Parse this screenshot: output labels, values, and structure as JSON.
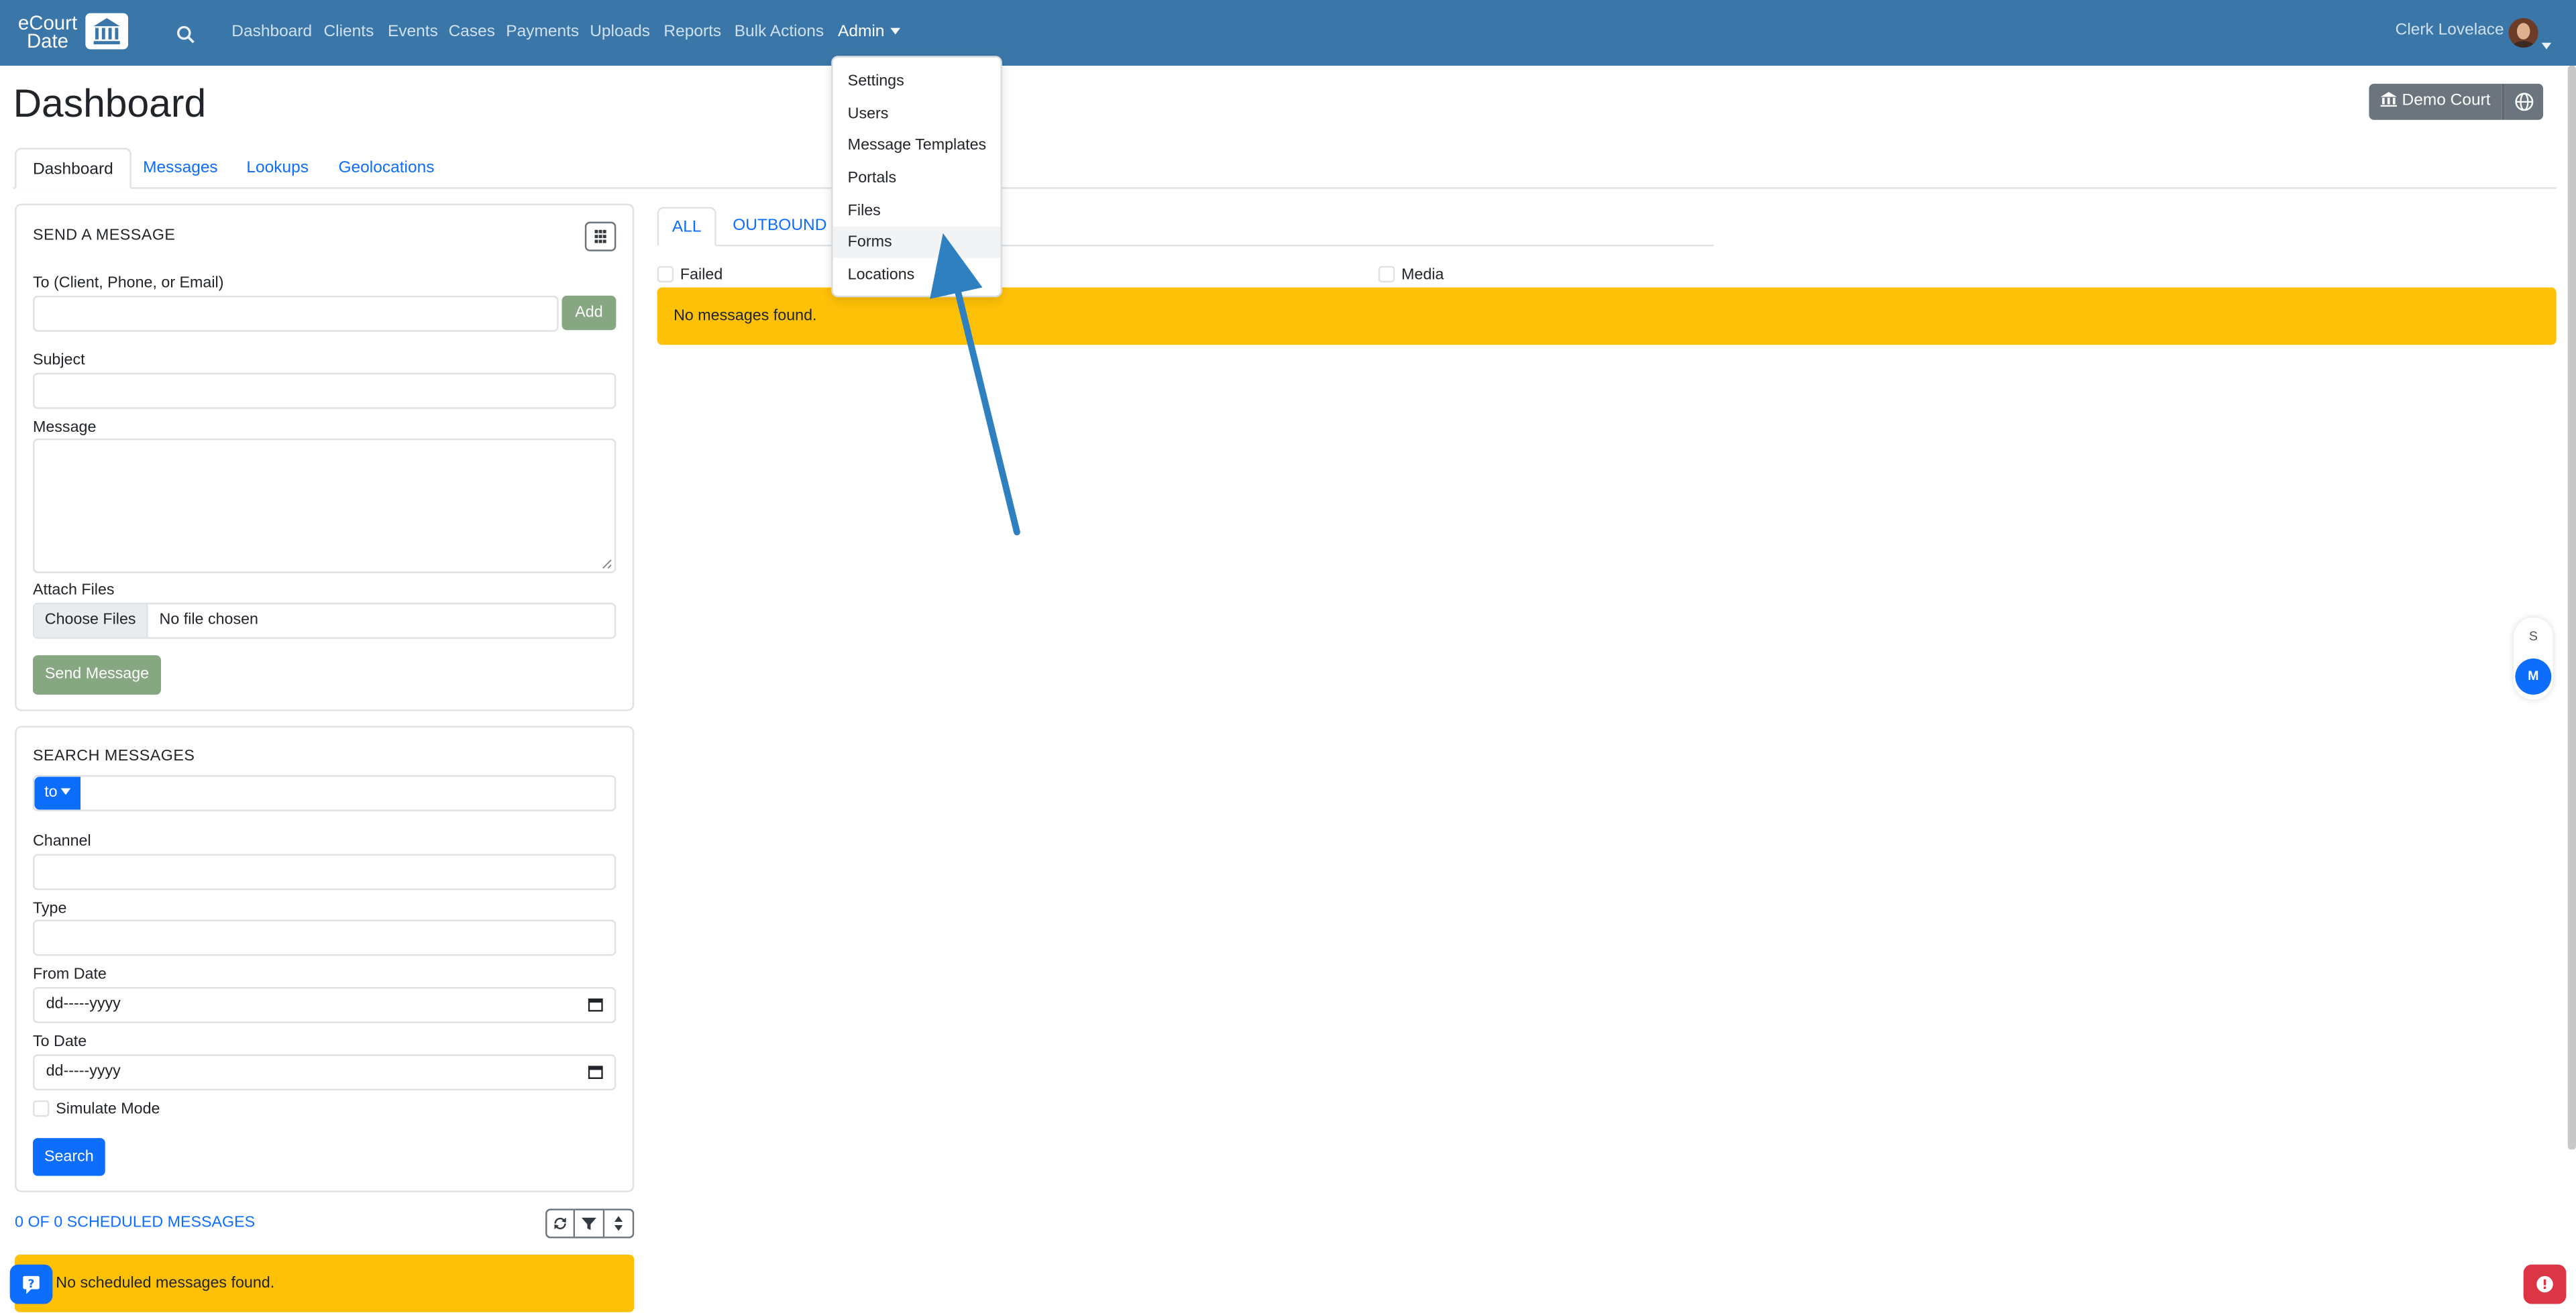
{
  "brand": {
    "line1": "eCourt",
    "line2": "Date"
  },
  "nav": {
    "items": [
      "Dashboard",
      "Clients",
      "Events",
      "Cases",
      "Payments",
      "Uploads",
      "Reports",
      "Bulk Actions"
    ],
    "admin_label": "Admin",
    "user_name": "Clerk Lovelace"
  },
  "admin_menu": [
    "Settings",
    "Users",
    "Message Templates",
    "Portals",
    "Files",
    "Forms",
    "Locations"
  ],
  "header": {
    "title": "Dashboard",
    "court_button": "Demo Court"
  },
  "tabs": [
    "Dashboard",
    "Messages",
    "Lookups",
    "Geolocations"
  ],
  "send_message": {
    "title": "SEND A MESSAGE",
    "to_label": "To (Client, Phone, or Email)",
    "add_button": "Add",
    "subject_label": "Subject",
    "message_label": "Message",
    "attach_label": "Attach Files",
    "choose_files": "Choose Files",
    "no_file": "No file chosen",
    "send_button": "Send Message"
  },
  "search_messages": {
    "title": "SEARCH MESSAGES",
    "to_select": "to",
    "channel_label": "Channel",
    "type_label": "Type",
    "from_date_label": "From Date",
    "from_date_placeholder": "dd-----yyyy",
    "to_date_label": "To Date",
    "to_date_placeholder": "dd-----yyyy",
    "simulate_label": "Simulate Mode",
    "search_button": "Search"
  },
  "scheduled": {
    "title": "0 OF 0 SCHEDULED MESSAGES",
    "alert": "No scheduled messages found."
  },
  "messages_panel": {
    "tabs": [
      "ALL",
      "OUTBOUND"
    ],
    "failed_label": "Failed",
    "media_label": "Media",
    "alert": "No messages found."
  },
  "side_bubbles": {
    "s": "S",
    "m": "M"
  },
  "colors": {
    "navbar": "#3a77a8",
    "primary": "#0d6efd",
    "warning": "#ffc107",
    "success_muted": "#86a782",
    "secondary": "#6c757d",
    "danger": "#dc3545",
    "arrow": "#2f80c0"
  }
}
